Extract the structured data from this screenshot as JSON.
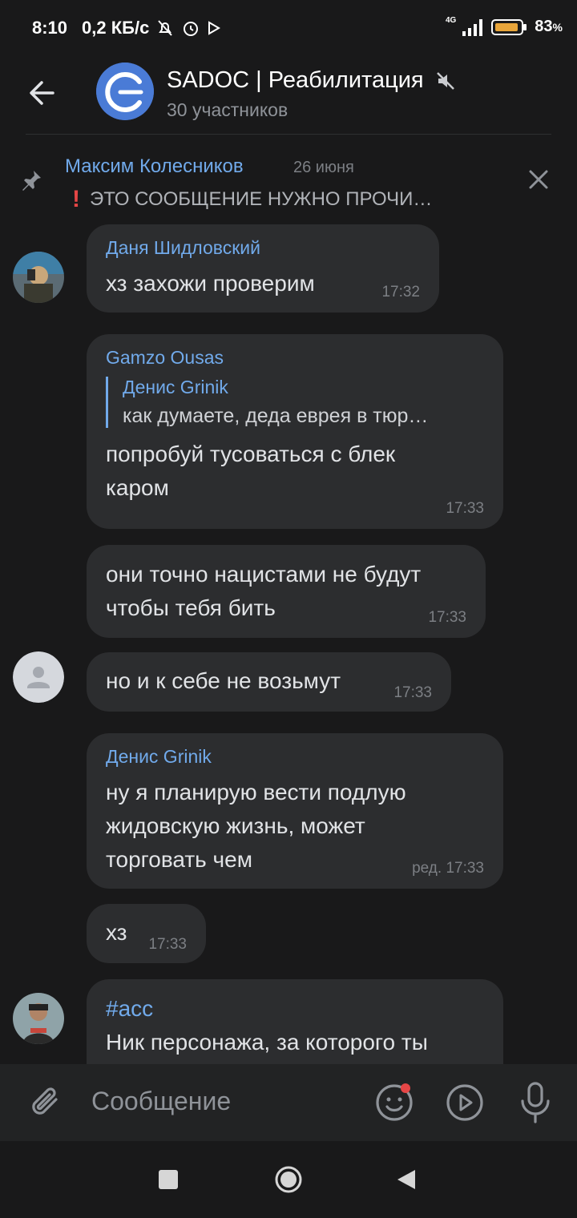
{
  "status_bar": {
    "time": "8:10",
    "speed": "0,2 КБ/с",
    "network": "4G",
    "battery": "83",
    "battery_unit": "%"
  },
  "header": {
    "title": "SADOC | Реабилитация",
    "subtitle": "30 участников",
    "muted": true
  },
  "pinned": {
    "author": "Максим Колесников",
    "date": "26 июня",
    "text": "ЭТО СООБЩЕНИЕ НУЖНО ПРОЧИ…"
  },
  "messages": [
    {
      "sender": "Даня Шидловский",
      "text": "хз захожи проверим",
      "time": "17:32"
    },
    {
      "sender": "Gamzo Ousas",
      "reply_to": {
        "name": "Денис Grinik",
        "text": "как думаете, деда еврея в тюр…"
      },
      "text_lines": [
        "попробуй тусоваться с блек",
        "каром"
      ],
      "time": "17:33"
    },
    {
      "text_lines": [
        "они точно нацистами не будут",
        "чтобы тебя бить"
      ],
      "time": "17:33"
    },
    {
      "text": "но и к себе не возьмут",
      "time": "17:33"
    },
    {
      "sender": "Денис Grinik",
      "text_lines": [
        "ну я планирую вести подлую",
        "жидовскую жизнь, может",
        "торговать чем"
      ],
      "time": "ред. 17:33"
    },
    {
      "text": "хз",
      "time": "17:33"
    },
    {
      "hashtag": "#acc",
      "text": "Ник персонажа, за которого ты"
    }
  ],
  "composer": {
    "placeholder": "Сообщение"
  },
  "colors": {
    "accent": "#71aaeb",
    "bubble": "#2c2d2f",
    "background": "#19191a",
    "notification_dot": "#e64646"
  }
}
